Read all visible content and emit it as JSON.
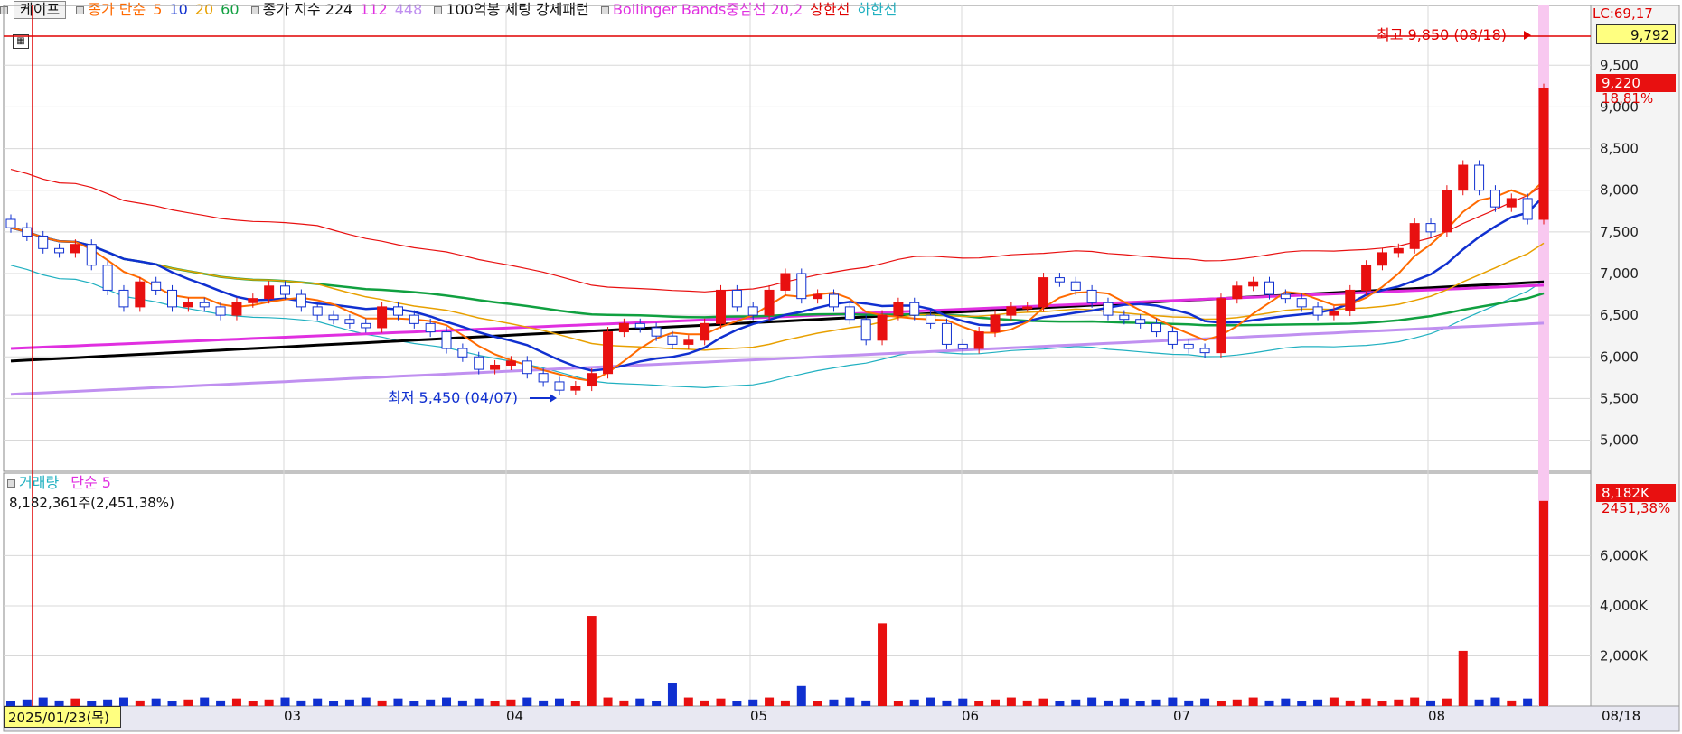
{
  "toolbar": {
    "stock_name": "케이프",
    "items": [
      {
        "label": "종가 단순",
        "color": "#ff6a00"
      },
      {
        "label": "5",
        "color": "#ff6a00"
      },
      {
        "label": "10",
        "color": "#1030d0"
      },
      {
        "label": "20",
        "color": "#e8a000"
      },
      {
        "label": "60",
        "color": "#10a040"
      },
      {
        "label": "종가 지수 224",
        "color": "#111111"
      },
      {
        "label": "112",
        "color": "#e030e0"
      },
      {
        "label": "448",
        "color": "#c090f0"
      },
      {
        "label": "100억봉 세팅 강세패턴",
        "color": "#111111"
      },
      {
        "label": "Bollinger Bands중심선 20,2",
        "color": "#e030e0"
      },
      {
        "label": "상한선",
        "color": "#e00000"
      },
      {
        "label": "하한선",
        "color": "#20b0c0"
      }
    ]
  },
  "price_axis": {
    "labels": [
      "9,500",
      "9,000",
      "8,500",
      "8,000",
      "7,500",
      "7,000",
      "6,500",
      "6,000",
      "5,500",
      "5,000"
    ]
  },
  "volume_axis": {
    "labels": [
      "6,000K",
      "4,000K",
      "2,000K"
    ]
  },
  "tags": {
    "lc": "LC:69,17",
    "current_price": "9,792",
    "close_price": "9,220",
    "close_change": "18,81%",
    "volume_last": "8,182K",
    "volume_change": "2451,38%"
  },
  "annotations": {
    "high": "최고 9,850 (08/18)",
    "low": "최저 5,450 (04/07)"
  },
  "volume_panel": {
    "title": "거래량",
    "ma_label": "단순 5",
    "info": "8,182,361주(2,451,38%)"
  },
  "date_axis": {
    "cursor_date": "2025/01/23(목)",
    "months": [
      "03",
      "04",
      "05",
      "06",
      "07",
      "08"
    ],
    "end_label": "08/18"
  },
  "chart_data": {
    "type": "candlestick",
    "title": "케이프",
    "ylim": [
      4700,
      9950
    ],
    "volume_ylim": [
      0,
      8500
    ],
    "series_close_path": [
      7550,
      7450,
      7300,
      7250,
      7350,
      7100,
      6800,
      6600,
      6900,
      6800,
      6600,
      6650,
      6600,
      6500,
      6650,
      6700,
      6850,
      6750,
      6600,
      6500,
      6450,
      6400,
      6350,
      6600,
      6500,
      6400,
      6300,
      6100,
      6000,
      5850,
      5900,
      5950,
      5800,
      5700,
      5600,
      5650,
      5800,
      6300,
      6400,
      6350,
      6250,
      6150,
      6200,
      6400,
      6800,
      6600,
      6500,
      6800,
      7000,
      6700,
      6750,
      6600,
      6450,
      6200,
      6500,
      6650,
      6500,
      6400,
      6150,
      6100,
      6300,
      6500,
      6600,
      6600,
      6950,
      6900,
      6800,
      6650,
      6500,
      6450,
      6400,
      6300,
      6150,
      6100,
      6050,
      6700,
      6850,
      6900,
      6750,
      6700,
      6600,
      6500,
      6550,
      6800,
      7100,
      7250,
      7300,
      7600,
      7500,
      8000,
      8300,
      8000,
      7800,
      7900,
      7650,
      9220
    ]
  }
}
